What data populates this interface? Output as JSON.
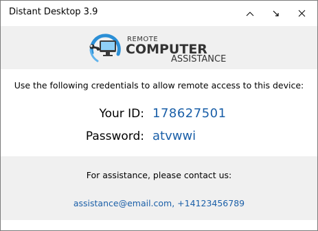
{
  "window": {
    "title": "Distant Desktop 3.9",
    "controls": {
      "minimize_icon": "minimize-icon",
      "maximize_icon": "restore-arrow-icon",
      "close_icon": "close-icon"
    }
  },
  "logo": {
    "line1": "REMOTE",
    "line2": "COMPUTER",
    "line3": "ASSISTANCE",
    "icon": "wrench-monitor-logo"
  },
  "credentials": {
    "instructions": "Use the following credentials to allow remote access to this device:",
    "id_label": "Your ID:",
    "id_value": "178627501",
    "password_label": "Password:",
    "password_value": "atvwwi"
  },
  "footer": {
    "title": "For assistance, please contact us:",
    "contact": "assistance@email.com, +14123456789"
  },
  "colors": {
    "accent_blue": "#1a5fa8",
    "band_gray": "#f0f0f0",
    "logo_blue": "#2b8fd6"
  }
}
